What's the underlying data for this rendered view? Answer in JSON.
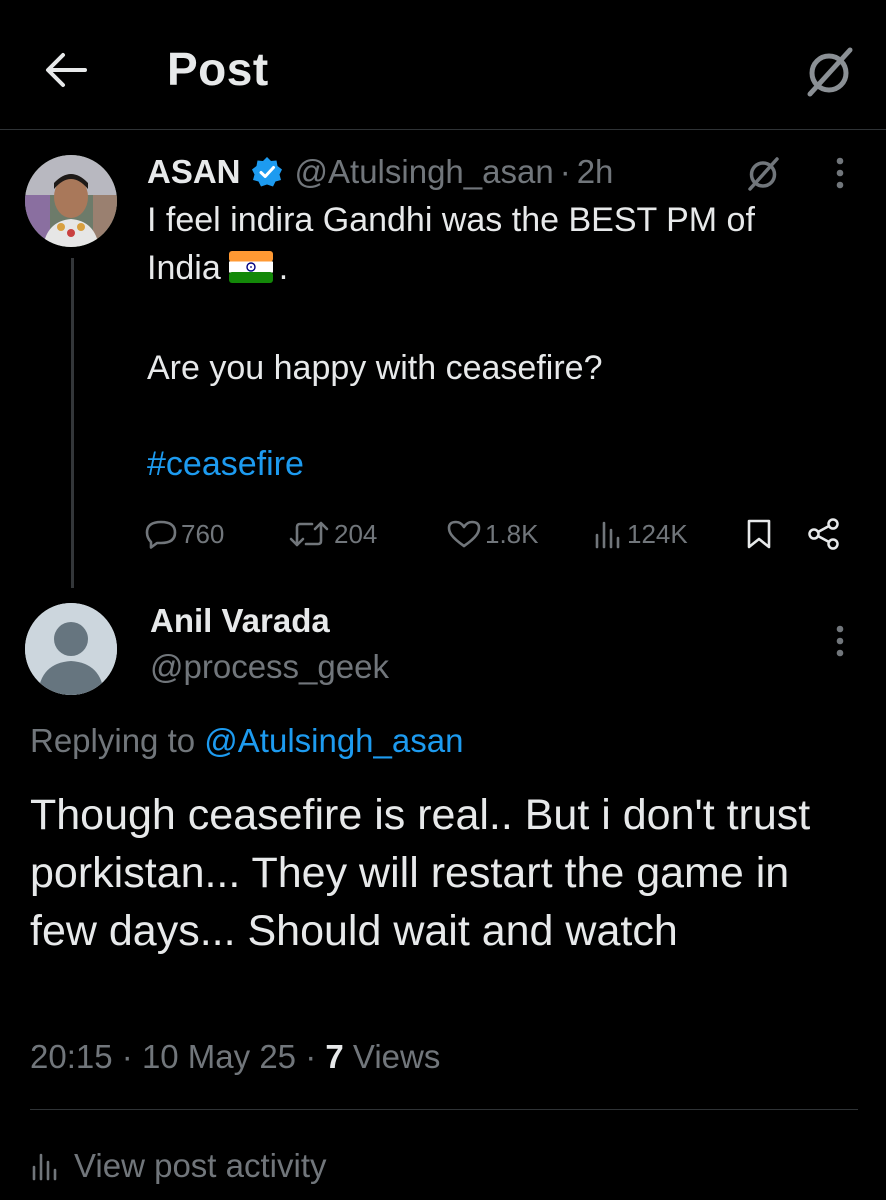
{
  "header": {
    "title": "Post",
    "back_icon": "arrow-left-icon",
    "grok_icon": "grok-icon"
  },
  "parent_post": {
    "author_name": "ASAN",
    "verified": true,
    "handle": "@Atulsingh_asan",
    "separator": "·",
    "time": "2h",
    "lines": [
      "I feel indira Gandhi was the BEST PM of",
      "India",
      "."
    ],
    "question": "Are you happy with ceasefire?",
    "hashtag": "#ceasefire",
    "flag_icon": "india-flag-icon",
    "stats": {
      "replies": "760",
      "reposts": "204",
      "likes": "1.8K",
      "views": "124K"
    }
  },
  "reply_post": {
    "author_name": "Anil Varada",
    "handle": "@process_geek",
    "replying_prefix": "Replying to",
    "replying_to": "@Atulsingh_asan",
    "text": "Though ceasefire is real.. But i don't trust porkistan... They will restart the game in few days... Should wait and watch",
    "time": "20:15",
    "date": "10 May 25",
    "separator": "·",
    "views_count": "7",
    "views_label": "Views"
  },
  "footer": {
    "activity_label": "View post activity"
  },
  "colors": {
    "background": "#000000",
    "text": "#e7e9ea",
    "muted": "#71767b",
    "link": "#1d9bf0",
    "verified": "#1d9bf0"
  }
}
